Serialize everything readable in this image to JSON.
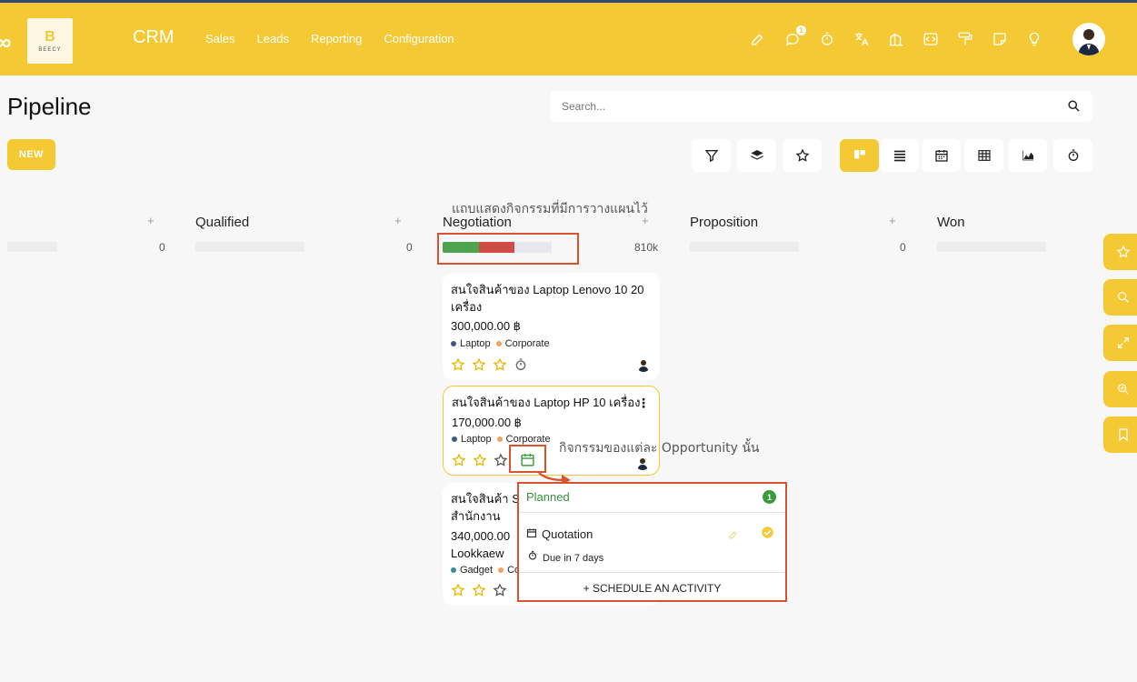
{
  "navbar": {
    "brand": "CRM",
    "logo_text": "BEECY",
    "menu": [
      "Sales",
      "Leads",
      "Reporting",
      "Configuration"
    ],
    "chat_badge": "1"
  },
  "page": {
    "title": "Pipeline",
    "new_label": "NEW",
    "search_placeholder": "Search..."
  },
  "columns": [
    {
      "title": "",
      "count": "0"
    },
    {
      "title": "Qualified",
      "count": "0"
    },
    {
      "title": "Negotiation",
      "count": "810k"
    },
    {
      "title": "Proposition",
      "count": "0"
    },
    {
      "title": "Won",
      "count": ""
    }
  ],
  "negotiation_progress": {
    "planned_fraction": 0.33,
    "overdue_fraction": 0.33
  },
  "annotations": {
    "progress_note": "แถบแสดงกิจกรรมที่มีการวางแผนไว้",
    "activity_note": "กิจกรรมของแต่ละ Opportunity นั้น"
  },
  "cards": [
    {
      "title": "สนใจสินค้าของ Laptop Lenovo 10 20 เครื่อง",
      "amount": "300,000.00 ฿",
      "tags": [
        {
          "name": "Laptop",
          "color": "#3d5a80"
        },
        {
          "name": "Corporate",
          "color": "#f0a35e"
        }
      ]
    },
    {
      "title": "สนใจสินค้าของ Laptop HP 10 เครื่อง",
      "amount": "170,000.00 ฿",
      "tags": [
        {
          "name": "Laptop",
          "color": "#3d5a80"
        },
        {
          "name": "Corporate",
          "color": "#f0a35e"
        }
      ]
    },
    {
      "title_line1": "สนใจสินค้า S",
      "title_line2": "สำนักงาน",
      "amount": "340,000.00",
      "customer": "Lookkaew",
      "tags": [
        {
          "name": "Gadget",
          "color": "#3a8f8f"
        },
        {
          "name": "Co",
          "color": "#f0a35e"
        }
      ]
    }
  ],
  "activity_popup": {
    "header": "Planned",
    "badge": "1",
    "activity": "Quotation",
    "due": "Due in 7 days",
    "schedule": "+ SCHEDULE AN ACTIVITY"
  },
  "colors": {
    "accent": "#f5c933",
    "annotation": "#d9532c",
    "planned": "#4ea44e",
    "overdue": "#d04d47"
  }
}
